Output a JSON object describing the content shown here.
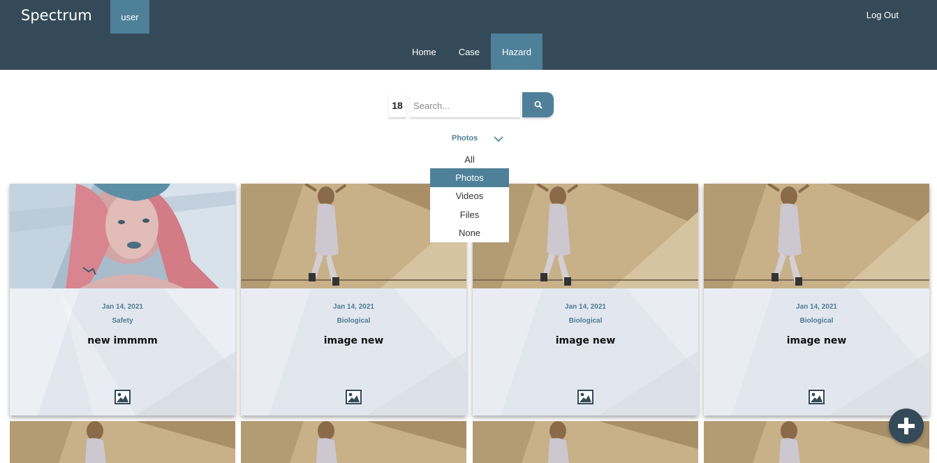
{
  "header": {
    "brand": "Spectrum",
    "user_label": "user",
    "logout_label": "Log Out",
    "nav": [
      {
        "label": "Home",
        "active": false
      },
      {
        "label": "Case",
        "active": false
      },
      {
        "label": "Hazard",
        "active": true
      }
    ]
  },
  "search": {
    "count": "18",
    "placeholder": "Search..."
  },
  "filter": {
    "selected": "Photos",
    "options": [
      "All",
      "Photos",
      "Videos",
      "Files",
      "None"
    ]
  },
  "cards": [
    {
      "date": "Jan 14, 2021",
      "category": "Safety",
      "title": "new immmm",
      "icon": "image-icon"
    },
    {
      "date": "Jan 14, 2021",
      "category": "Biological",
      "title": "image new",
      "icon": "image-icon"
    },
    {
      "date": "Jan 14, 2021",
      "category": "Biological",
      "title": "image new",
      "icon": "image-icon"
    },
    {
      "date": "Jan 14, 2021",
      "category": "Biological",
      "title": "image new",
      "icon": "image-icon"
    }
  ],
  "colors": {
    "header_bg": "#344a58",
    "accent": "#4f8099"
  },
  "fab_icon": "plus-icon"
}
